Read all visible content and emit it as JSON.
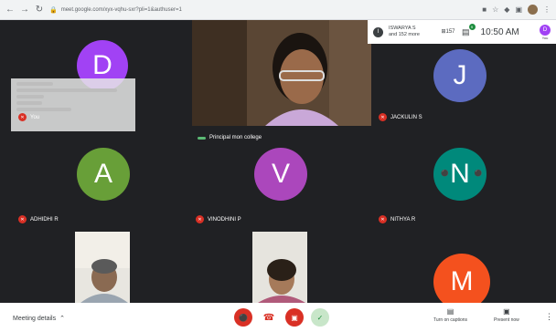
{
  "browser": {
    "url": "meet.google.com/xyx-vqhu-sxr?pli=1&authuser=1"
  },
  "topbar": {
    "people_initial": "I",
    "people_line1": "ISWARYA S",
    "people_line2": "and 152 more",
    "count_icon": "⊞157",
    "chat_badge": "9",
    "time": "10:50 AM",
    "self_initial": "D",
    "self_label": "You"
  },
  "tiles": [
    {
      "initial": "D",
      "name": "You",
      "color": "#a142f4"
    },
    {
      "name": "Principal mon college"
    },
    {
      "initial": "J",
      "name": "JACKULIN S",
      "color": "#5c6bc0"
    },
    {
      "initial": "A",
      "name": "ADHIDHI R",
      "color": "#689f38"
    },
    {
      "initial": "V",
      "name": "VINODHINI P",
      "color": "#ab47bc"
    },
    {
      "initial": "N",
      "name": "NITHYA R",
      "color": "#00897b"
    },
    {
      "name": ""
    },
    {
      "name": ""
    },
    {
      "initial": "M",
      "name": "",
      "color": "#f4511e"
    }
  ],
  "controls": {
    "meeting_details": "Meeting details",
    "captions": "Turn on captions",
    "present": "Present now"
  },
  "colors": {
    "mic_off": "#d93025",
    "leave": "#d93025",
    "accept": "#1e8e3e"
  }
}
